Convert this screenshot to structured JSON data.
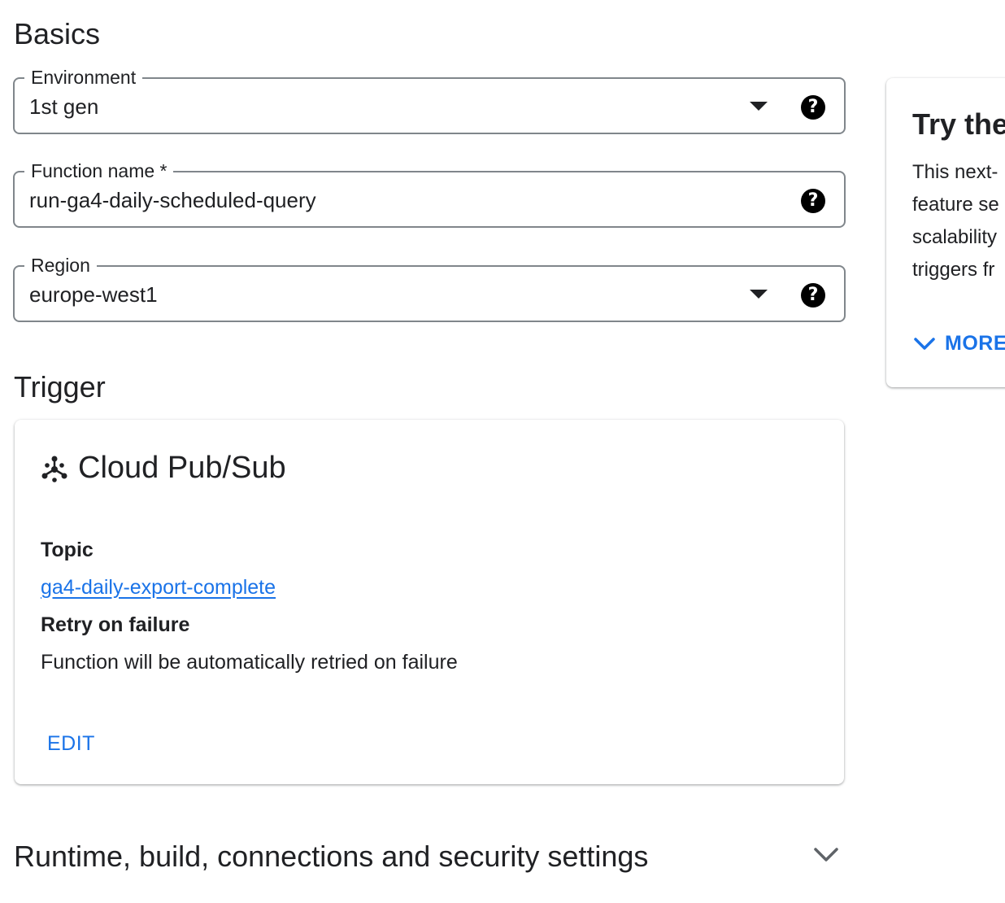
{
  "basics": {
    "title": "Basics",
    "environment": {
      "label": "Environment",
      "value": "1st gen"
    },
    "function_name": {
      "label": "Function name *",
      "value": "run-ga4-daily-scheduled-query"
    },
    "region": {
      "label": "Region",
      "value": "europe-west1"
    },
    "help_icon": "help-circle-icon",
    "dropdown_icon": "arrow-drop-down-icon"
  },
  "side_panel": {
    "title": "Try the",
    "lines": [
      "This next-",
      "feature se",
      "scalability",
      "triggers fr"
    ],
    "more_label": "MORE",
    "more_icon": "chevron-down-icon"
  },
  "trigger": {
    "title": "Trigger",
    "card": {
      "icon": "pubsub-icon",
      "name": "Cloud Pub/Sub",
      "topic_label": "Topic",
      "topic_value": "ga4-daily-export-complete",
      "retry_label": "Retry on failure",
      "retry_value": "Function will be automatically retried on failure",
      "edit_label": "EDIT"
    }
  },
  "runtime": {
    "title": "Runtime, build, connections and security settings",
    "icon": "expand-more-icon"
  },
  "colors": {
    "accent": "#1a73e8",
    "text": "#202124",
    "outline": "#80868b"
  }
}
